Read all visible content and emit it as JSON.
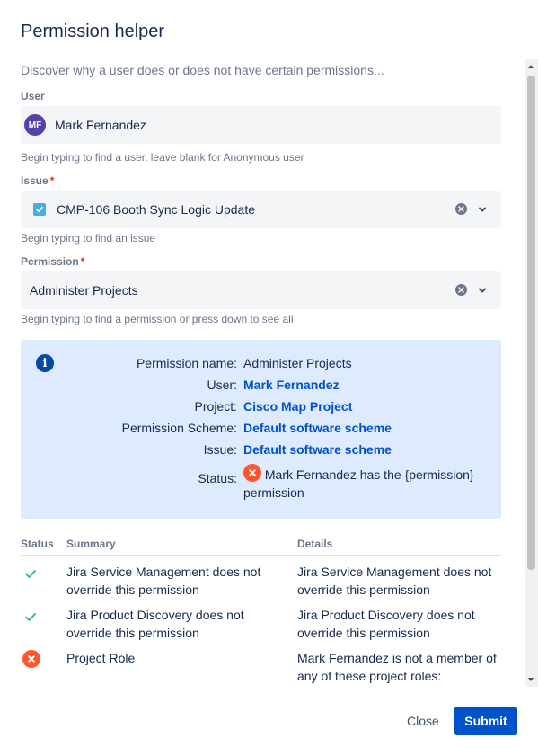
{
  "dialog": {
    "title": "Permission helper",
    "description": "Discover why a user does or does not have certain permissions..."
  },
  "user_field": {
    "label": "User",
    "avatar_initials": "MF",
    "avatar_color": "#5243aa",
    "value": "Mark Fernandez",
    "helper": "Begin typing to find a user, leave blank for Anonymous user"
  },
  "issue_field": {
    "label": "Issue",
    "required_mark": "*",
    "icon": "task-checkbox-icon",
    "value": "CMP-106 Booth Sync Logic Update",
    "helper": "Begin typing to find an issue"
  },
  "permission_field": {
    "label": "Permission",
    "required_mark": "*",
    "value": "Administer Projects",
    "helper": "Begin typing to find a permission or press down to see all"
  },
  "info": {
    "rows": [
      {
        "key": "Permission name:",
        "value": "Administer Projects"
      },
      {
        "key": "User:",
        "value": "Mark Fernandez"
      },
      {
        "key": "Project:",
        "value": "Cisco Map Project"
      },
      {
        "key": "Permission Scheme:",
        "value": "Default software scheme"
      },
      {
        "key": "Issue:",
        "value": "Default software scheme"
      }
    ],
    "status_key": "Status:",
    "status_value": "Mark Fernandez has the {permission} permission",
    "background": "#deebff"
  },
  "table": {
    "headers": {
      "status": "Status",
      "summary": "Summary",
      "details": "Details"
    },
    "rows": [
      {
        "status": "success",
        "summary": "Jira Service Management does not override this permission",
        "details": "Jira Service Management does not override this permission"
      },
      {
        "status": "success",
        "summary": "Jira Product Discovery does not override this permission",
        "details": "Jira Product Discovery does not override this permission"
      },
      {
        "status": "error",
        "summary": "Project Role",
        "details": "Mark Fernandez is not a member of any of these project roles:"
      }
    ]
  },
  "footer": {
    "close_label": "Close",
    "submit_label": "Submit",
    "primary_color": "#0052cc"
  },
  "colors": {
    "success": "#36b37e",
    "error": "#ff5630",
    "link": "#0052cc"
  }
}
